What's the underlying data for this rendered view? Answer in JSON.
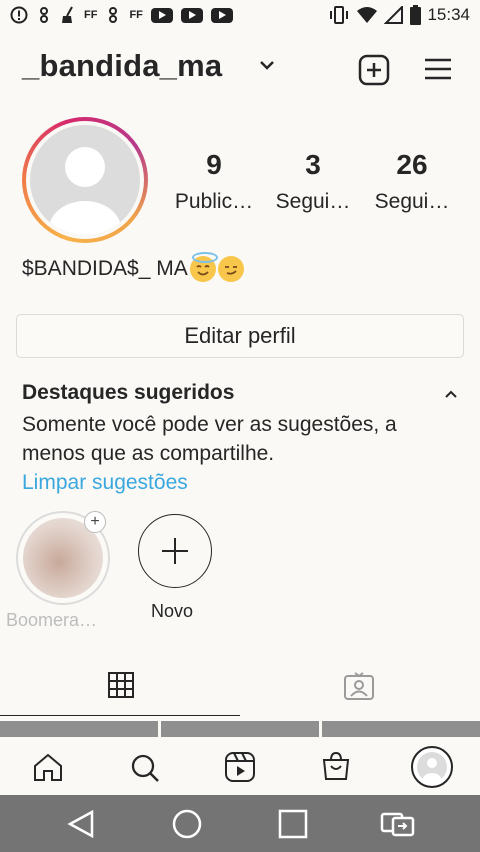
{
  "status_bar": {
    "time": "15:34",
    "left_labels": [
      "FF",
      "FF"
    ],
    "left_icons": [
      "alert-icon",
      "stacked-icon",
      "broom-icon",
      "fb-icon",
      "youtube-icon",
      "youtube-icon",
      "youtube-icon"
    ],
    "right_icons": [
      "vibrate-icon",
      "wifi-icon",
      "signal-icon",
      "battery-icon"
    ]
  },
  "header": {
    "username": "_bandida_ma",
    "icons": [
      "chevron-down-icon",
      "new-post-icon",
      "menu-icon"
    ]
  },
  "profile": {
    "stats": [
      {
        "value": "9",
        "label": "Public…"
      },
      {
        "value": "3",
        "label": "Segui…"
      },
      {
        "value": "26",
        "label": "Segui…"
      }
    ],
    "bio": "$BANDIDA$_ MA"
  },
  "edit_profile": {
    "label": "Editar perfil"
  },
  "suggested": {
    "title": "Destaques sugeridos",
    "description": "Somente você pode ver as sugestões, a menos que as compartilhe.",
    "clear_label": "Limpar sugestões"
  },
  "highlights": [
    {
      "label": "Boomera…"
    },
    {
      "label": "Novo"
    }
  ],
  "tabs": [
    "grid-icon",
    "tagged-icon"
  ],
  "bottom_nav": [
    "home-icon",
    "search-icon",
    "reels-icon",
    "shop-icon",
    "profile-avatar"
  ],
  "system_nav": [
    "back-icon",
    "home-circle-icon",
    "recents-icon",
    "switch-app-icon"
  ],
  "colors": {
    "link": "#3aa7de",
    "text": "#262626",
    "background": "#faf9f6",
    "system_nav": "#747474"
  }
}
